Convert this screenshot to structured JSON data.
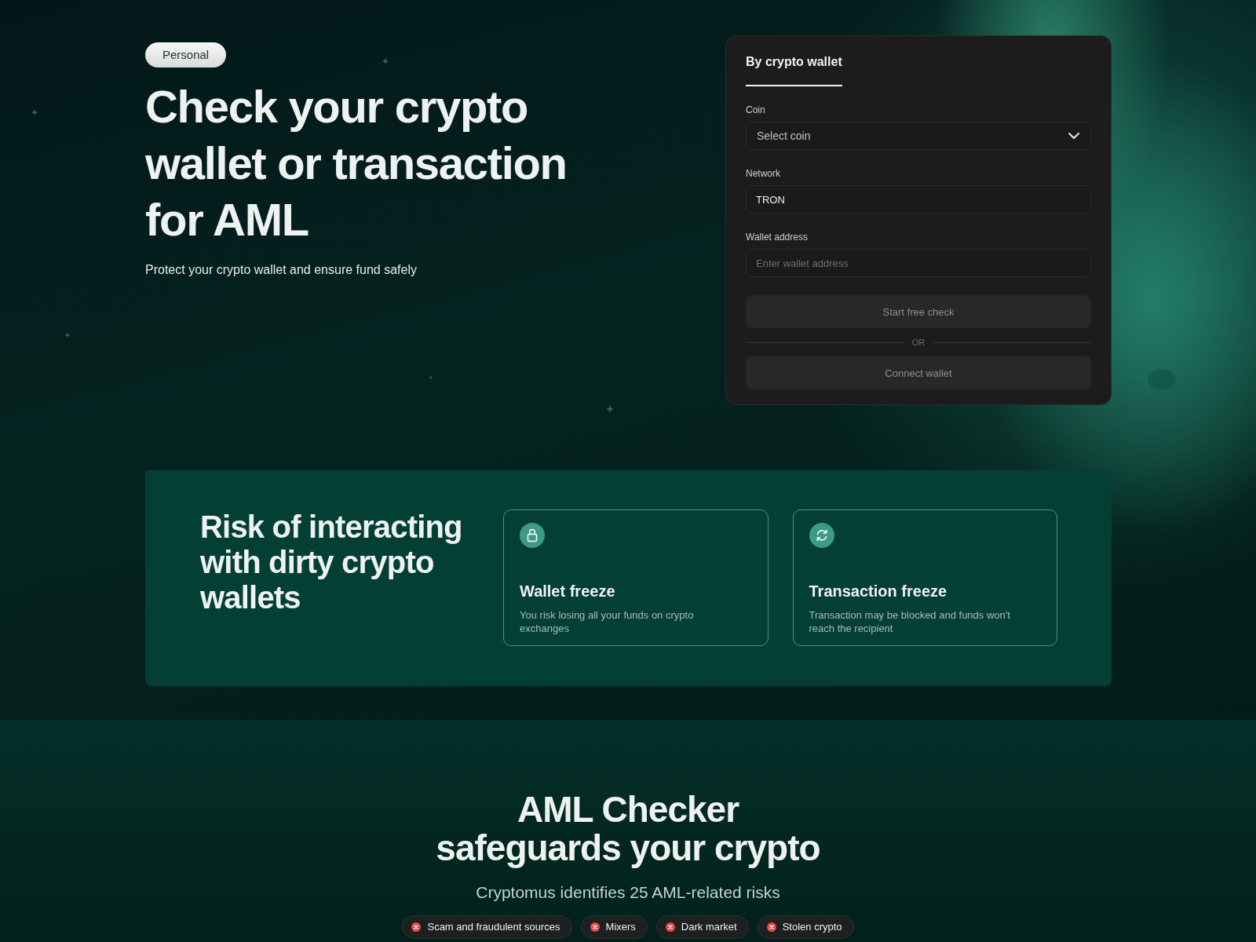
{
  "hero": {
    "badge": "Personal",
    "title": "Check your crypto wallet or transaction for AML",
    "subtitle": "Protect your crypto wallet and ensure fund safely"
  },
  "check_form": {
    "tabs": [
      {
        "label": "By crypto wallet",
        "selected": true
      }
    ],
    "fields": [
      {
        "kind": "select",
        "label": "Coin",
        "placeholder": "Select coin"
      },
      {
        "kind": "text",
        "label": "Network",
        "value": "TRON"
      },
      {
        "kind": "text",
        "label": "Wallet address",
        "placeholder": "Enter wallet address"
      }
    ],
    "submit_button": {
      "label": "Start free check",
      "disabled": true
    },
    "divider": "OR",
    "connect_button": {
      "label": "Connect wallet",
      "disabled": true
    }
  },
  "risks": {
    "title": "Risk of interacting with dirty crypto wallets",
    "cards": [
      {
        "kind": "wallet",
        "title": "Wallet freeze",
        "description": "You risk losing all your funds on crypto exchanges"
      },
      {
        "kind": "transaction",
        "title": "Transaction freeze",
        "description": "Transaction may be blocked and funds won't reach the recipient"
      }
    ]
  },
  "safeguards": {
    "title": "AML Checker safeguards your crypto",
    "subtitle": "Cryptomus identifies 25 AML-related risks",
    "tags": [
      "Scam and fraudulent sources",
      "Mixers",
      "Dark market",
      "Stolen crypto"
    ]
  }
}
